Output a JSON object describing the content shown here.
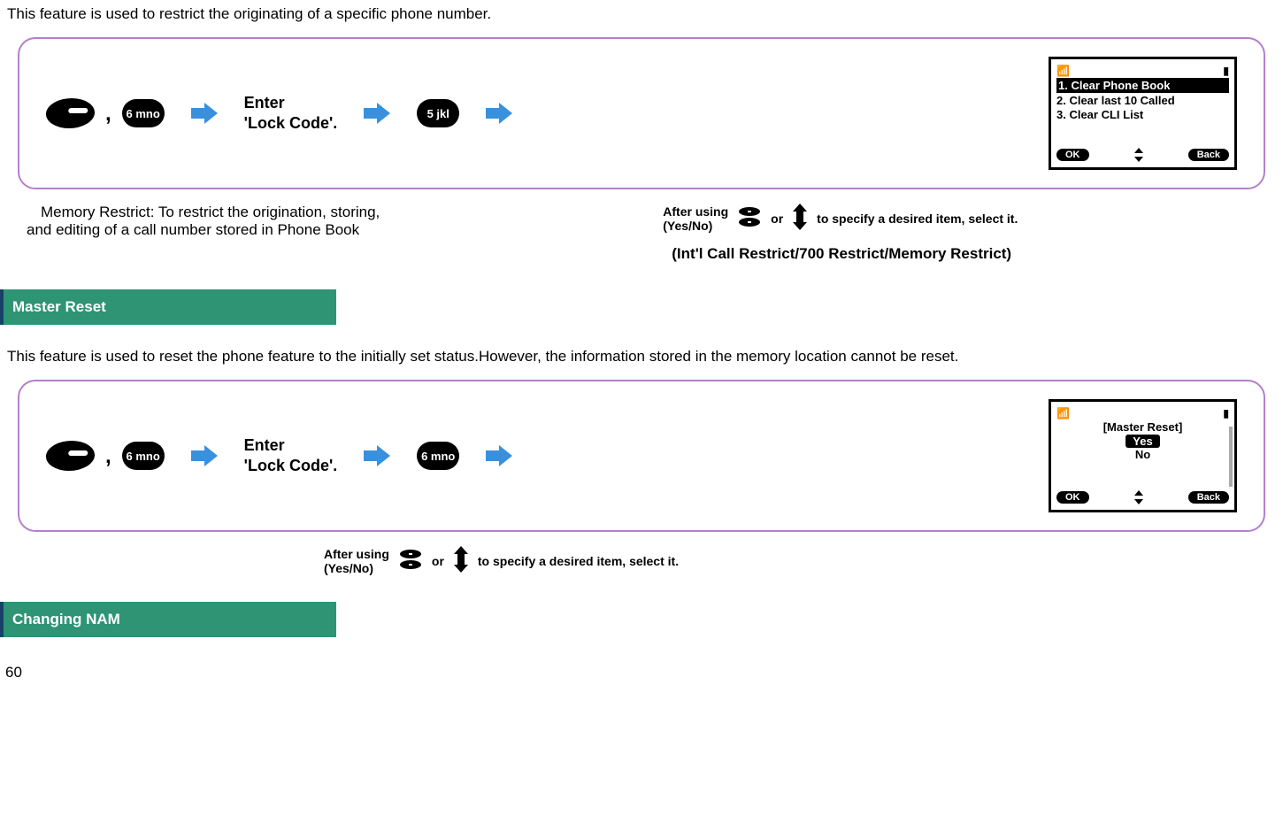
{
  "intro1": "This feature is used to restrict the originating of a specific phone number.",
  "box1": {
    "enter_line1": "Enter",
    "enter_line2": "'Lock Code'.",
    "key6": "6 mno",
    "key5": "5 jkl",
    "comma": ","
  },
  "screen1": {
    "item1": "1. Clear Phone Book",
    "item2": "2. Clear last 10 Called",
    "item3": "3. Clear CLI List",
    "ok": "OK",
    "back": "Back"
  },
  "note1": {
    "line1": "Memory Restrict: To restrict the origination, storing,",
    "line2": "and editing of a call number stored in Phone Book"
  },
  "after_using": {
    "text1": "After using",
    "text2": "(Yes/No)",
    "or": "or",
    "tail": "to specify a desired item, select it."
  },
  "caption1": "(Int'l Call Restrict/700 Restrict/Memory Restrict)",
  "section_master_reset": "Master Reset",
  "intro2_a": "This feature is used to reset the phone feature to the initially set status.",
  "intro2_b": "However, the information stored in the memory location cannot be reset.",
  "box2": {
    "enter_line1": "Enter",
    "enter_line2": "'Lock Code'.",
    "key6a": "6 mno",
    "key6b": "6 mno",
    "comma": ","
  },
  "screen2": {
    "title": "[Master Reset]",
    "yes": "Yes",
    "no": "No",
    "ok": "OK",
    "back": "Back"
  },
  "section_changing_nam": "Changing NAM",
  "page_num": "60"
}
